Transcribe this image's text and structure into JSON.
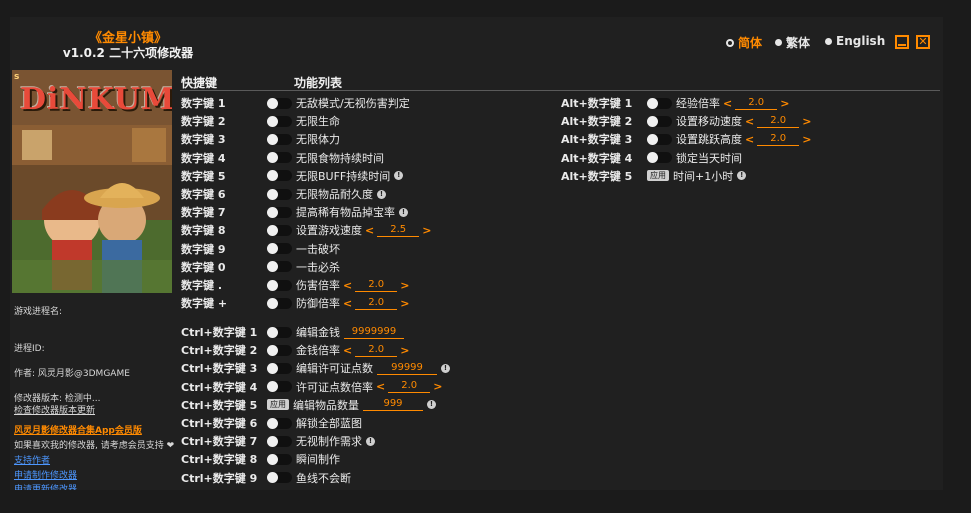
{
  "app": {
    "title": "《金星小镇》",
    "subtitle": "v1.0.2 二十六项修改器"
  },
  "languages": [
    {
      "label": "简体",
      "selected": true
    },
    {
      "label": "繁体",
      "selected": false
    },
    {
      "label": "English",
      "selected": false
    }
  ],
  "window_controls": {
    "minimize_icon": "minimize-icon",
    "close_icon": "close-icon",
    "close_glyph": "✕"
  },
  "cover": {
    "logo_text": "DiNKUM",
    "corner_text": "s"
  },
  "sidebar": {
    "process_name_label": "游戏进程名:",
    "process_id_label": "进程ID:",
    "author": "作者: 风灵月影@3DMGAME",
    "version_status": "修改器版本: 检测中...",
    "check_update": "检查修改器版本更新",
    "promo": "风灵月影修改器合集App会员版",
    "support_text": "如果喜欢我的修改器, 请考虑会员支持 ❤",
    "links": [
      "支持作者",
      "申请制作修改器",
      "申请更新修改器"
    ]
  },
  "headers": {
    "hotkey": "快捷键",
    "features": "功能列表"
  },
  "left_features": [
    {
      "key": "数字键 1",
      "label": "无敌模式/无视伤害判定"
    },
    {
      "key": "数字键 2",
      "label": "无限生命"
    },
    {
      "key": "数字键 3",
      "label": "无限体力"
    },
    {
      "key": "数字键 4",
      "label": "无限食物持续时间"
    },
    {
      "key": "数字键 5",
      "label": "无限BUFF持续时间",
      "info": true
    },
    {
      "key": "数字键 6",
      "label": "无限物品耐久度",
      "info": true
    },
    {
      "key": "数字键 7",
      "label": "提高稀有物品掉宝率",
      "info": true
    },
    {
      "key": "数字键 8",
      "label": "设置游戏速度",
      "value": "2.5"
    },
    {
      "key": "数字键 9",
      "label": "一击破坏"
    },
    {
      "key": "数字键 0",
      "label": "一击必杀"
    },
    {
      "key": "数字键 .",
      "label": "伤害倍率",
      "value": "2.0"
    },
    {
      "key": "数字键 +",
      "label": "防御倍率",
      "value": "2.0"
    }
  ],
  "ctrl_features": [
    {
      "key": "Ctrl+数字键 1",
      "label": "编辑金钱",
      "input": "9999999"
    },
    {
      "key": "Ctrl+数字键 2",
      "label": "金钱倍率",
      "value": "2.0"
    },
    {
      "key": "Ctrl+数字键 3",
      "label": "编辑许可证点数",
      "input": "99999",
      "info": true
    },
    {
      "key": "Ctrl+数字键 4",
      "label": "许可证点数倍率",
      "value": "2.0"
    },
    {
      "key": "Ctrl+数字键 5",
      "label": "编辑物品数量",
      "input": "999",
      "info": true,
      "apply": "应用"
    },
    {
      "key": "Ctrl+数字键 6",
      "label": "解锁全部蓝图"
    },
    {
      "key": "Ctrl+数字键 7",
      "label": "无视制作需求",
      "info": true
    },
    {
      "key": "Ctrl+数字键 8",
      "label": "瞬间制作"
    },
    {
      "key": "Ctrl+数字键 9",
      "label": "鱼线不会断"
    }
  ],
  "alt_features": [
    {
      "key": "Alt+数字键 1",
      "label": "经验倍率",
      "value": "2.0"
    },
    {
      "key": "Alt+数字键 2",
      "label": "设置移动速度",
      "value": "2.0"
    },
    {
      "key": "Alt+数字键 3",
      "label": "设置跳跃高度",
      "value": "2.0"
    },
    {
      "key": "Alt+数字键 4",
      "label": "锁定当天时间"
    },
    {
      "key": "Alt+数字键 5",
      "label": "时间+1小时",
      "info": true,
      "apply": "应用"
    }
  ],
  "glyphs": {
    "left_arrow": "<",
    "right_arrow": ">",
    "info": "!"
  },
  "colors": {
    "accent": "#ff8a00",
    "background": "#202020",
    "link": "#4d97ff"
  }
}
